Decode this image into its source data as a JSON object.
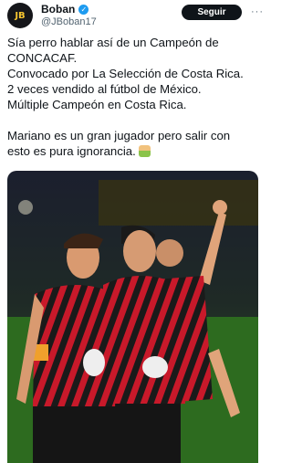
{
  "author": {
    "name": "Boban",
    "handle": "@JBoban17",
    "avatar_initials": "JB"
  },
  "follow_label": "Seguir",
  "tweet_lines": [
    "Sía perro hablar así de un Campeón de",
    "CONCACAF.",
    "Convocado por La Selección de Costa Rica.",
    "2 veces vendido al fútbol de México.",
    "Múltiple Campeón en Costa Rica.",
    "",
    "Mariano es un gran jugador pero salir con",
    "esto es pura ignorancia."
  ],
  "colors": {
    "verified": "#1d9bf0",
    "follow_bg": "#0f1419",
    "kit_red": "#d11a2a",
    "kit_black": "#1a1a1a",
    "pitch": "#2d6b1f"
  },
  "icons": {
    "verified": "verified-badge-icon",
    "more": "more-options-icon",
    "emoji": "person-facepalming-emoji"
  }
}
